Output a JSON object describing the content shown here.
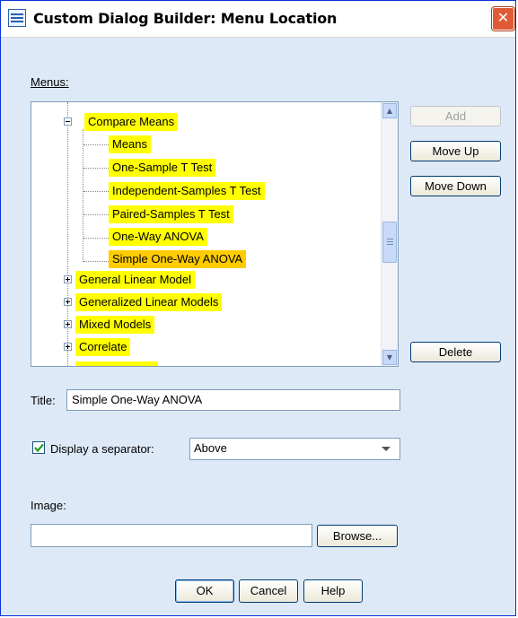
{
  "window": {
    "title": "Custom Dialog Builder: Menu Location",
    "close_symbol": "✕"
  },
  "menus": {
    "label": "Menus:",
    "items": [
      {
        "label": "Compare Means",
        "expanded": true
      },
      {
        "label": "Means"
      },
      {
        "label": "One-Sample T Test"
      },
      {
        "label": "Independent-Samples T Test"
      },
      {
        "label": "Paired-Samples T Test"
      },
      {
        "label": "One-Way ANOVA"
      },
      {
        "label": "Simple One-Way ANOVA",
        "selected": true
      },
      {
        "label": "General Linear Model",
        "expanded": false
      },
      {
        "label": "Generalized Linear Models",
        "expanded": false
      },
      {
        "label": "Mixed Models",
        "expanded": false
      },
      {
        "label": "Correlate",
        "expanded": false
      }
    ],
    "highlight_color": "#ffff00",
    "selected_color": "#ffcc00"
  },
  "buttons": {
    "add": "Add",
    "move_up": "Move Up",
    "move_down": "Move Down",
    "delete": "Delete",
    "browse": "Browse...",
    "ok": "OK",
    "cancel": "Cancel",
    "help": "Help"
  },
  "title_field": {
    "label": "Title:",
    "value": "Simple One-Way ANOVA"
  },
  "separator": {
    "checkbox_label": "Display a separator:",
    "checked": true,
    "selected_option": "Above"
  },
  "image_field": {
    "label": "Image:",
    "value": ""
  }
}
